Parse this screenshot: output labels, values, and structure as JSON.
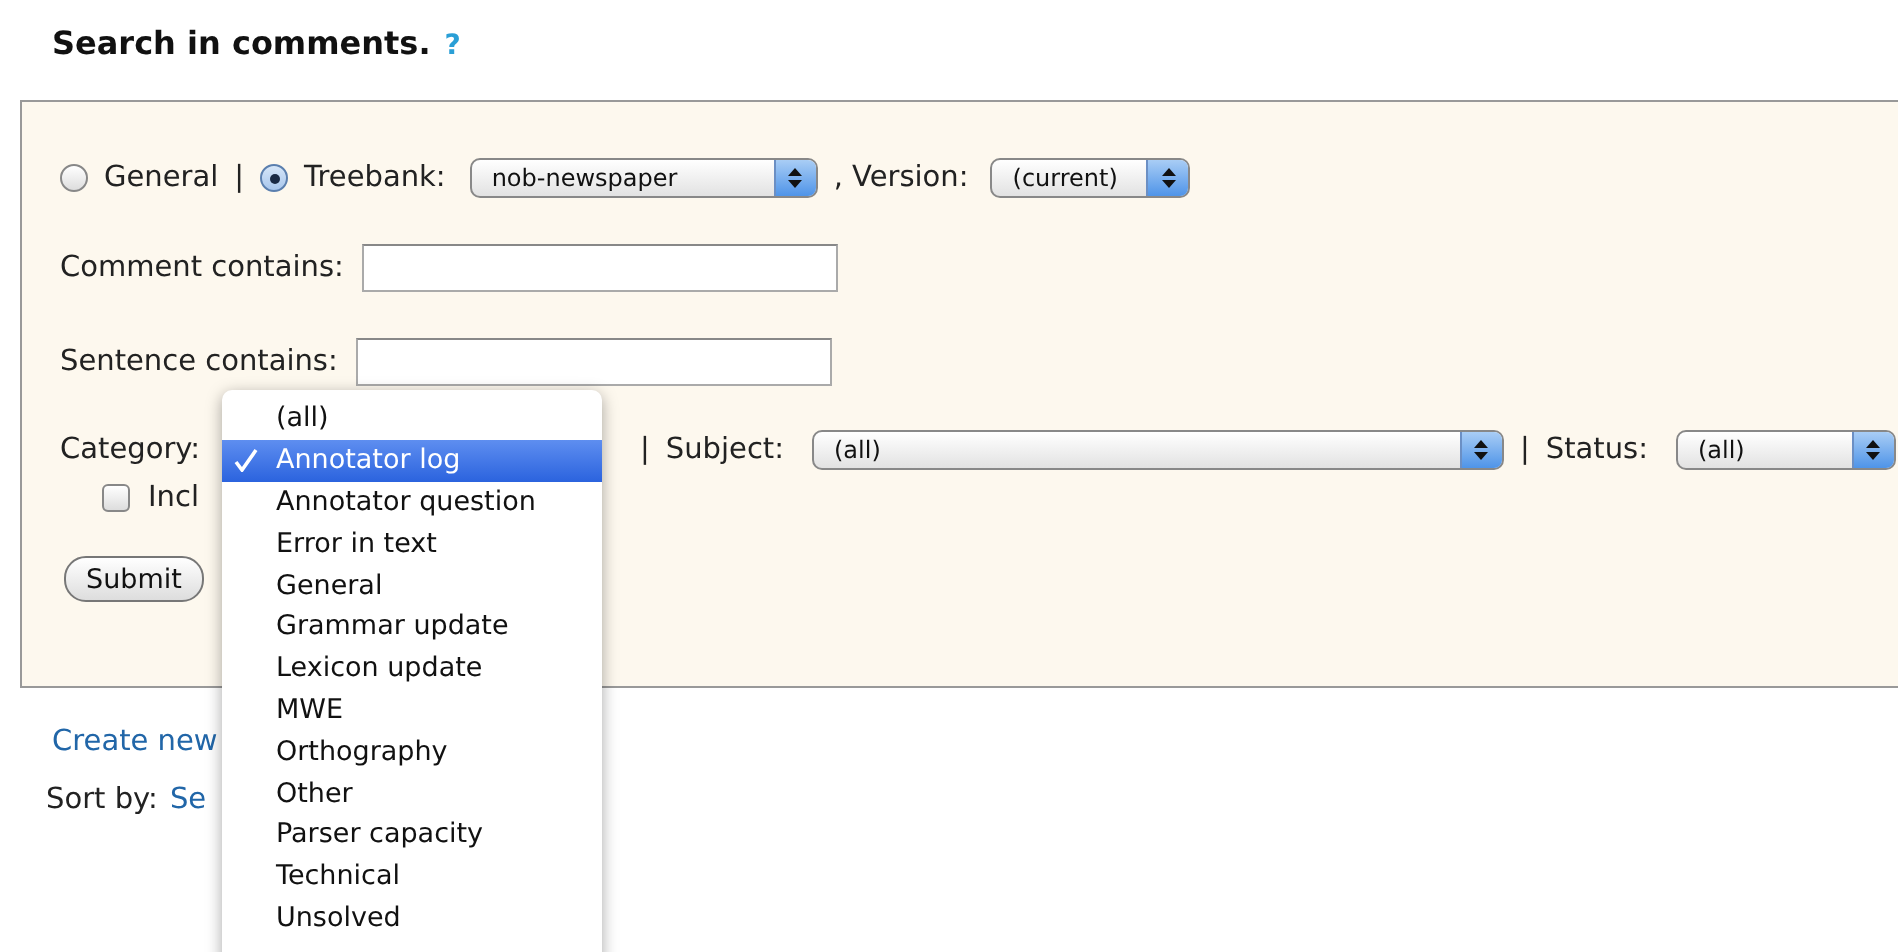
{
  "title": "Search in comments.",
  "help_link": "?",
  "scope": [
    {
      "label": "General",
      "selected": false
    },
    {
      "label": "Treebank:",
      "selected": true
    }
  ],
  "scope_separator": "|",
  "treebank": {
    "value": "nob-newspaper"
  },
  "version": {
    "label": ", Version:",
    "value": "(current)"
  },
  "comment": {
    "label": "Comment contains:"
  },
  "sentence": {
    "label": "Sentence contains:"
  },
  "category": {
    "label": "Category:",
    "options": [
      {
        "label": "(all)",
        "selected": false
      },
      {
        "label": "Annotator log",
        "selected": true
      },
      {
        "label": "Annotator question",
        "selected": false
      },
      {
        "label": "Error in text",
        "selected": false
      },
      {
        "label": "General",
        "selected": false
      },
      {
        "label": "Grammar update",
        "selected": false
      },
      {
        "label": "Lexicon update",
        "selected": false
      },
      {
        "label": "MWE",
        "selected": false
      },
      {
        "label": "Orthography",
        "selected": false
      },
      {
        "label": "Other",
        "selected": false
      },
      {
        "label": "Parser capacity",
        "selected": false
      },
      {
        "label": "Technical",
        "selected": false
      },
      {
        "label": "Unsolved",
        "selected": false
      }
    ]
  },
  "subject": {
    "separator": "|",
    "label": "Subject:",
    "value": "(all)"
  },
  "status": {
    "separator": "|",
    "label": "Status:",
    "value": "(all)"
  },
  "include": {
    "label": "Incl",
    "checked": false
  },
  "submit": "Submit",
  "create_link": "Create new",
  "sort": {
    "label": "Sort by:",
    "link": "Se"
  }
}
